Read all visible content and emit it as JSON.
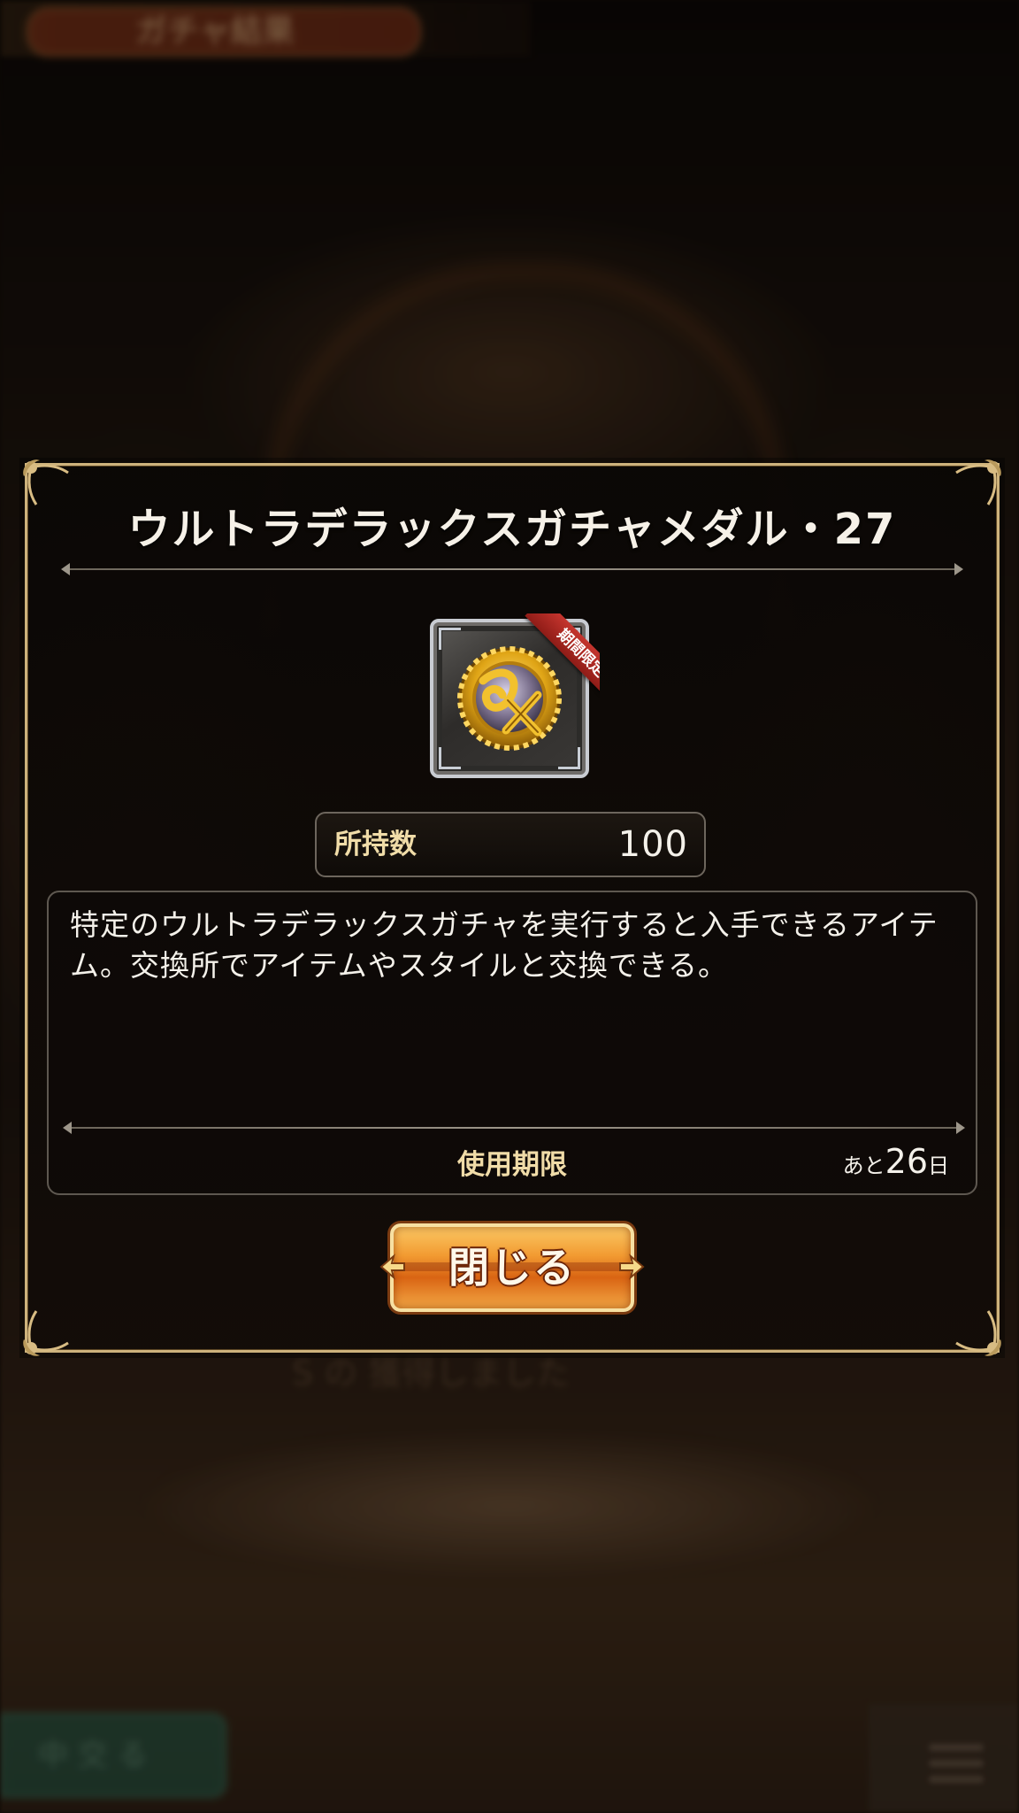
{
  "background": {
    "header_text": "ガチャ結果",
    "footer_text": "S の 獲得しました",
    "bottom_left_text": "中 交 る"
  },
  "modal": {
    "title": "ウルトラデラックスガチャメダル・27",
    "item": {
      "icon": "dx-medal-icon",
      "badge": "期間限定"
    },
    "owned": {
      "label": "所持数",
      "value": "100"
    },
    "description": "特定のウルトラデラックスガチャを実行すると入手できるアイテム。交換所でアイテムやスタイルと交換できる。",
    "expiry": {
      "label": "使用期限",
      "prefix": "あと",
      "days": "26",
      "unit": "日"
    },
    "close_label": "閉じる"
  },
  "colors": {
    "frame_gold": "#cdb27c",
    "label_gold": "#f0dca8",
    "button_orange": "#f29b32",
    "badge_red": "#c5352e"
  }
}
